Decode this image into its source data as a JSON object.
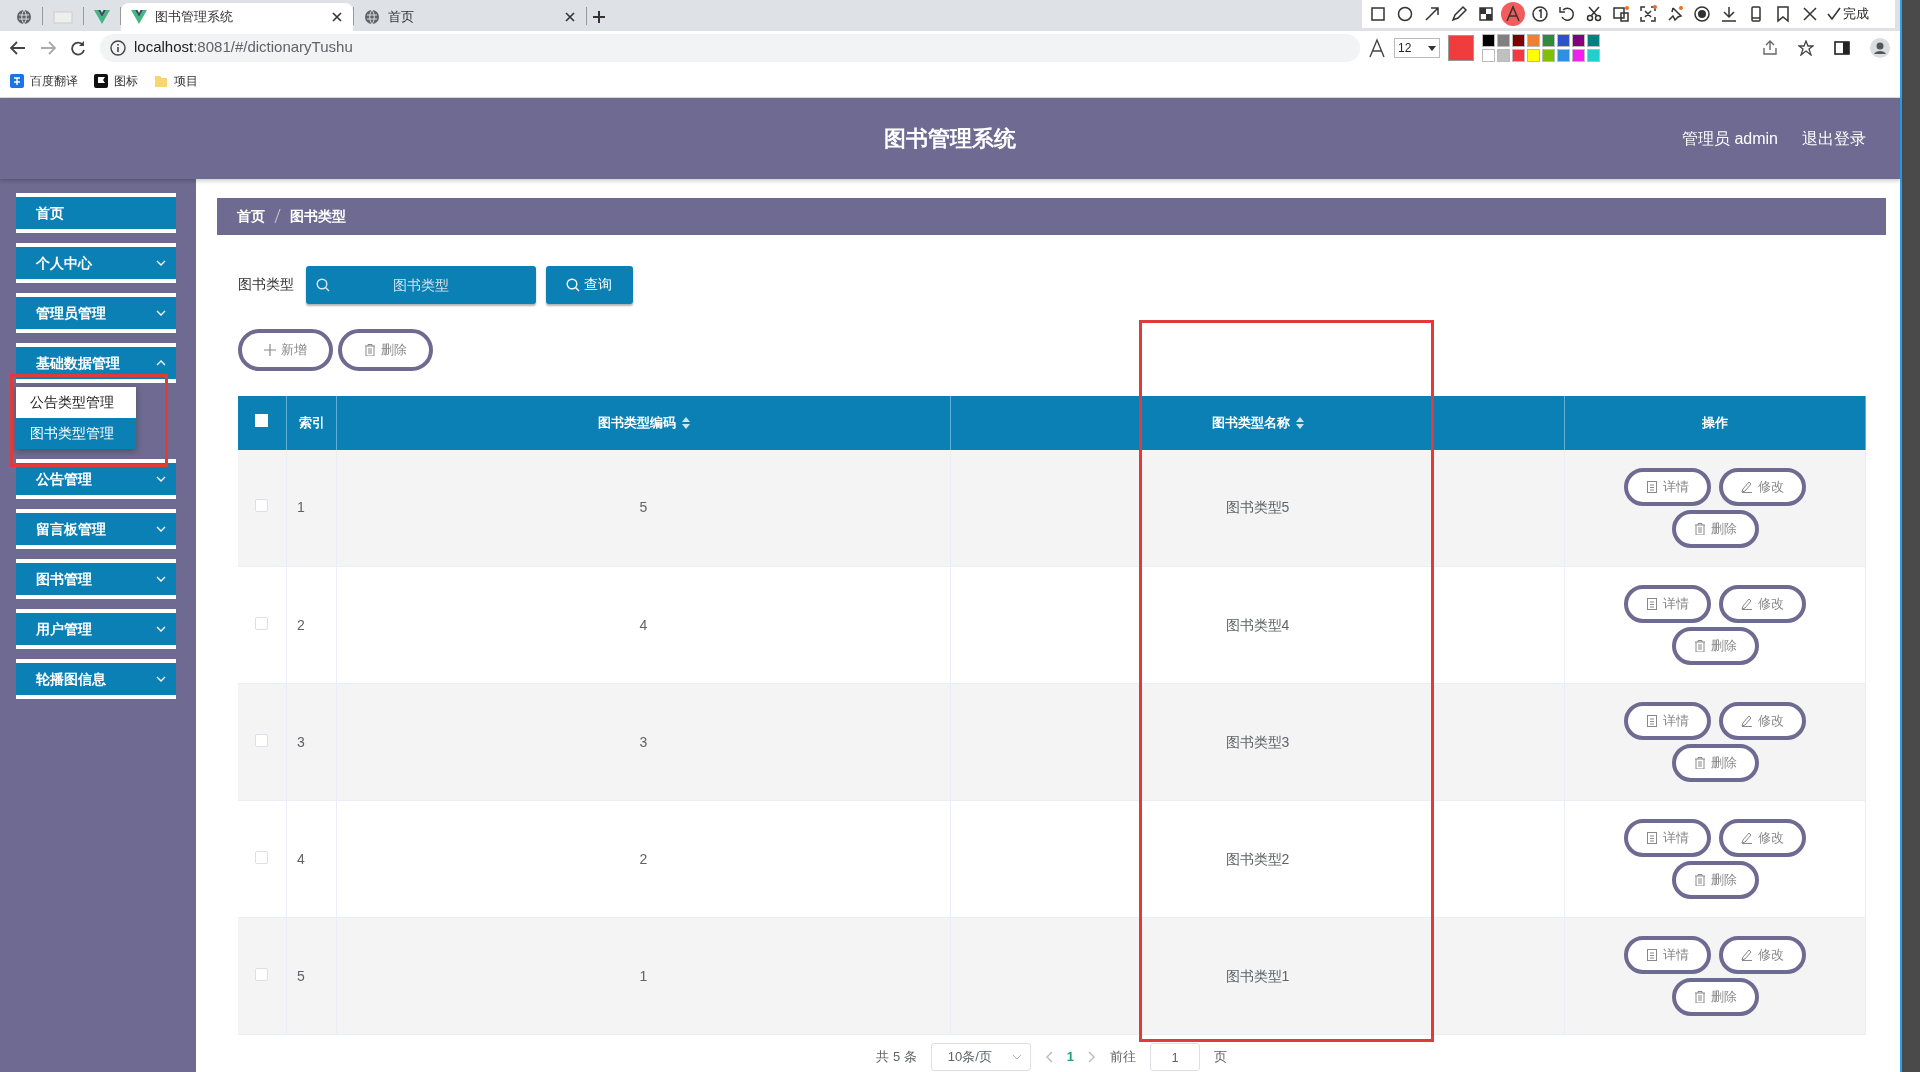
{
  "browser_tabs": [
    {
      "kind": "globe",
      "selected": false
    },
    {
      "kind": "blank",
      "selected": false
    },
    {
      "kind": "vue",
      "selected": false
    },
    {
      "kind": "vue",
      "title": "图书管理系统",
      "selected": true
    },
    {
      "kind": "globe",
      "title": "首页",
      "selected": false
    }
  ],
  "address": {
    "host": "localhost",
    "rest": ":8081/#/dictionaryTushu"
  },
  "bookmarks": [
    {
      "kind": "translate",
      "label": "百度翻译"
    },
    {
      "kind": "flag",
      "label": "图标"
    },
    {
      "kind": "folder",
      "label": "项目"
    }
  ],
  "annotation_toolbar": {
    "tools": [
      {
        "selected": false
      },
      {
        "selected": false
      },
      {
        "selected": false
      },
      {
        "selected": false
      },
      {
        "selected": false
      },
      {
        "selected": true
      },
      {
        "selected": false
      },
      {
        "selected": false
      },
      {
        "selected": false
      },
      {
        "selected": false
      },
      {
        "selected": false
      },
      {
        "selected": false
      },
      {
        "selected": false
      },
      {
        "selected": false
      },
      {
        "selected": false
      },
      {
        "selected": false
      },
      {
        "selected": false
      }
    ],
    "done": "完成",
    "font_size": "12",
    "current": {
      "color": "#f03c3c"
    },
    "swatches": [
      {
        "color": "#000000"
      },
      {
        "color": "#808080"
      },
      {
        "color": "#800000"
      },
      {
        "color": "#f08030"
      },
      {
        "color": "#2e8b3e"
      },
      {
        "color": "#3050d0"
      },
      {
        "color": "#800080"
      },
      {
        "color": "#008080"
      },
      {
        "color": "#ffffff"
      },
      {
        "color": "#c0c0c0"
      },
      {
        "color": "#f03c3c"
      },
      {
        "color": "#ffff00"
      },
      {
        "color": "#80c000"
      },
      {
        "color": "#3090e0"
      },
      {
        "color": "#f020f0"
      },
      {
        "color": "#20d0d0"
      }
    ]
  },
  "app": {
    "title": "图书管理系统",
    "user": "管理员 admin",
    "logout": "退出登录"
  },
  "sidebar": {
    "items": [
      {
        "kind": "link",
        "label": "首页"
      },
      {
        "kind": "menu",
        "label": "个人中心",
        "expanded": false
      },
      {
        "kind": "menu",
        "label": "管理员管理",
        "expanded": false
      },
      {
        "kind": "menu",
        "label": "基础数据管理",
        "expanded": true,
        "children": [
          {
            "label": "公告类型管理",
            "selected": true
          },
          {
            "label": "图书类型管理",
            "selected": false
          }
        ]
      },
      {
        "kind": "menu",
        "label": "公告管理",
        "expanded": false
      },
      {
        "kind": "menu",
        "label": "留言板管理",
        "expanded": false
      },
      {
        "kind": "menu",
        "label": "图书管理",
        "expanded": false
      },
      {
        "kind": "menu",
        "label": "用户管理",
        "expanded": false
      },
      {
        "kind": "menu",
        "label": "轮播图信息",
        "expanded": false
      }
    ]
  },
  "breadcrumb": [
    "首页",
    "图书类型"
  ],
  "search": {
    "label": "图书类型",
    "placeholder": "图书类型",
    "button": "查询"
  },
  "actions": [
    {
      "kind": "add",
      "label": "新增"
    },
    {
      "kind": "delete",
      "label": "删除"
    }
  ],
  "table": {
    "header_checked": false,
    "columns": [
      {
        "label": "索引",
        "sortable": false
      },
      {
        "label": "图书类型编码",
        "sortable": true
      },
      {
        "label": "图书类型名称",
        "sortable": true
      },
      {
        "label": "操作",
        "sortable": false
      }
    ],
    "rows": [
      {
        "checked": false,
        "cells": [
          "1",
          "5",
          "图书类型5"
        ],
        "actions": [
          {
            "kind": "detail",
            "label": "详情"
          },
          {
            "kind": "edit",
            "label": "修改"
          },
          {
            "kind": "delete",
            "label": "删除"
          }
        ]
      },
      {
        "checked": false,
        "cells": [
          "2",
          "4",
          "图书类型4"
        ],
        "actions": [
          {
            "kind": "detail",
            "label": "详情"
          },
          {
            "kind": "edit",
            "label": "修改"
          },
          {
            "kind": "delete",
            "label": "删除"
          }
        ]
      },
      {
        "checked": false,
        "cells": [
          "3",
          "3",
          "图书类型3"
        ],
        "actions": [
          {
            "kind": "detail",
            "label": "详情"
          },
          {
            "kind": "edit",
            "label": "修改"
          },
          {
            "kind": "delete",
            "label": "删除"
          }
        ]
      },
      {
        "checked": false,
        "cells": [
          "4",
          "2",
          "图书类型2"
        ],
        "actions": [
          {
            "kind": "detail",
            "label": "详情"
          },
          {
            "kind": "edit",
            "label": "修改"
          },
          {
            "kind": "delete",
            "label": "删除"
          }
        ]
      },
      {
        "checked": false,
        "cells": [
          "5",
          "1",
          "图书类型1"
        ],
        "actions": [
          {
            "kind": "detail",
            "label": "详情"
          },
          {
            "kind": "edit",
            "label": "修改"
          },
          {
            "kind": "delete",
            "label": "删除"
          }
        ]
      }
    ]
  },
  "pagination": {
    "total": "共 5 条",
    "page_size": "10条/页",
    "pages": [
      {
        "label": "1",
        "selected": true
      }
    ],
    "goto_label": "前往",
    "goto_value": "1",
    "goto_suffix": "页"
  }
}
